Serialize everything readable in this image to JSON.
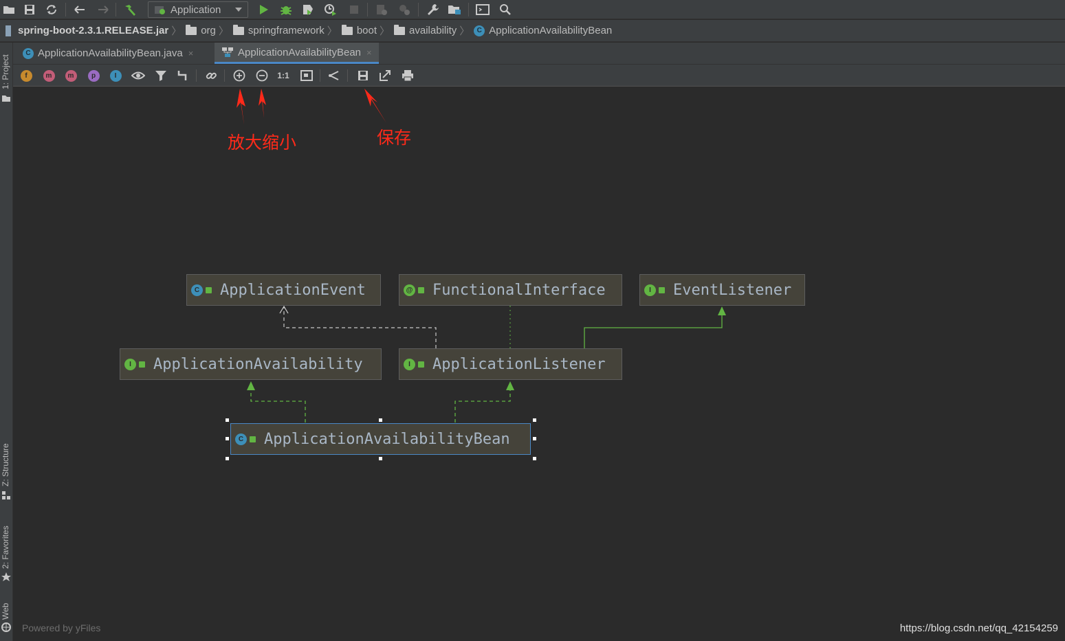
{
  "toolbar": {
    "run_config_label": "Application"
  },
  "breadcrumb": {
    "items": [
      "spring-boot-2.3.1.RELEASE.jar",
      "org",
      "springframework",
      "boot",
      "availability",
      "ApplicationAvailabilityBean"
    ]
  },
  "left_strip": {
    "project_label": "1: Project",
    "structure_label": "Z: Structure",
    "favorites_label": "2: Favorites",
    "web_label": "Web"
  },
  "tabs": [
    {
      "label": "ApplicationAvailabilityBean.java",
      "close": "×",
      "active": false
    },
    {
      "label": "ApplicationAvailabilityBean",
      "close": "×",
      "active": true
    }
  ],
  "diagram_toolbar": {
    "badges": {
      "fields": "f",
      "constructors": "m",
      "methods": "m",
      "properties": "p",
      "inner": "I"
    },
    "actual_size_label": "1:1"
  },
  "diagram": {
    "nodes": {
      "application_event": {
        "label": "ApplicationEvent",
        "badge": "C",
        "kind": "class"
      },
      "functional_interface": {
        "label": "FunctionalInterface",
        "badge": "@",
        "kind": "annotation"
      },
      "event_listener": {
        "label": "EventListener",
        "badge": "I",
        "kind": "interface"
      },
      "application_availability": {
        "label": "ApplicationAvailability",
        "badge": "I",
        "kind": "interface"
      },
      "application_listener": {
        "label": "ApplicationListener",
        "badge": "I",
        "kind": "interface"
      },
      "application_availability_bean": {
        "label": "ApplicationAvailabilityBean",
        "badge": "C",
        "kind": "class"
      }
    }
  },
  "annotations": {
    "zoom": "放大缩小",
    "save": "保存"
  },
  "footer": {
    "powered_by": "Powered by yFiles",
    "watermark": "https://blog.csdn.net/qq_42154259"
  },
  "colors": {
    "background": "#2b2b2b",
    "panel": "#3c3f41",
    "node_fill": "#45433a",
    "class_badge": "#3d8fb8",
    "interface_badge": "#62b543",
    "annotation_badge": "#62b543",
    "realization_edge": "#62b543",
    "annotation_arrow": "#ff2a1a",
    "selection": "#4a88c7"
  }
}
